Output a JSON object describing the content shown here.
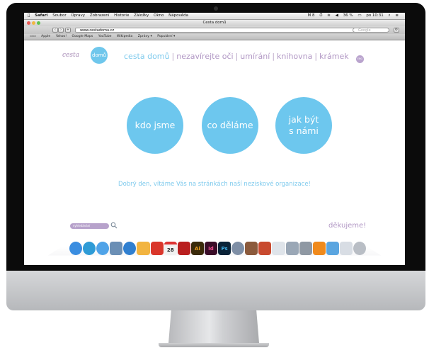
{
  "menubar": {
    "apple": "",
    "app": "Safari",
    "items": [
      "Soubor",
      "Úpravy",
      "Zobrazení",
      "Historie",
      "Záložky",
      "Okno",
      "Nápověda"
    ],
    "status_right": "M 8",
    "battery": "36 %",
    "clock": "po 10:31"
  },
  "browser": {
    "window_title": "Cesta domů",
    "url": "www.cestadomu.cz",
    "search_placeholder": "Google",
    "bookmarks": [
      "Apple",
      "Yahoo!",
      "Google Maps",
      "YouTube",
      "Wikipedia",
      "Zprávy ▾",
      "Populární ▾"
    ]
  },
  "site": {
    "logo_script": "cesta",
    "logo_circle": "domů",
    "nav": [
      "cesta domů",
      "nezavírejte oči",
      "umírání",
      "knihovna",
      "krámek"
    ],
    "lang_dot": "ENG",
    "circles": [
      "kdo jsme",
      "co děláme",
      "jak být s námi"
    ],
    "welcome": "Dobrý den, vítáme Vás na stránkách naší neziskové organizace!",
    "search_placeholder": "vyhledávání",
    "thanks": "děkujeme!"
  },
  "dock": {
    "icons": [
      {
        "name": "finder-icon",
        "color": "#3a8de0",
        "label": ""
      },
      {
        "name": "safari-icon",
        "color": "#2e9bd6",
        "label": ""
      },
      {
        "name": "messages-icon",
        "color": "#4fa3e8",
        "label": ""
      },
      {
        "name": "preview-icon",
        "color": "#6b8fb5",
        "label": ""
      },
      {
        "name": "itunes-icon",
        "color": "#2f7fd0",
        "label": ""
      },
      {
        "name": "notes-icon",
        "color": "#f2b440",
        "label": ""
      },
      {
        "name": "acrobat-icon",
        "color": "#d9362b",
        "label": ""
      },
      {
        "name": "calendar-icon",
        "color": "#f1f1f1",
        "label": "28"
      },
      {
        "name": "acrobat-pro-icon",
        "color": "#b91f1f",
        "label": ""
      },
      {
        "name": "illustrator-icon",
        "color": "#3a2a0a",
        "label": "Ai"
      },
      {
        "name": "indesign-icon",
        "color": "#3a0d28",
        "label": "Id"
      },
      {
        "name": "photoshop-icon",
        "color": "#0a2338",
        "label": "Ps"
      },
      {
        "name": "tools-icon",
        "color": "#7f8fa6",
        "label": ""
      },
      {
        "name": "photo-browser-icon",
        "color": "#8b5a3c",
        "label": ""
      },
      {
        "name": "books-icon",
        "color": "#c84a2f",
        "label": ""
      },
      {
        "name": "textedit-icon",
        "color": "#dfe4ea",
        "label": ""
      },
      {
        "name": "directory-icon",
        "color": "#9aa7b6",
        "label": ""
      },
      {
        "name": "system-preferences-icon",
        "color": "#8f98a3",
        "label": ""
      },
      {
        "name": "vlc-icon",
        "color": "#f08a1c",
        "label": ""
      },
      {
        "name": "folder-icon",
        "color": "#5aa5e0",
        "label": ""
      },
      {
        "name": "documents-icon",
        "color": "#d8dde4",
        "label": ""
      },
      {
        "name": "trash-icon",
        "color": "#b9bec5",
        "label": ""
      }
    ]
  },
  "colors": {
    "site_blue": "#6dc7ee",
    "site_purple": "#b197c4"
  }
}
